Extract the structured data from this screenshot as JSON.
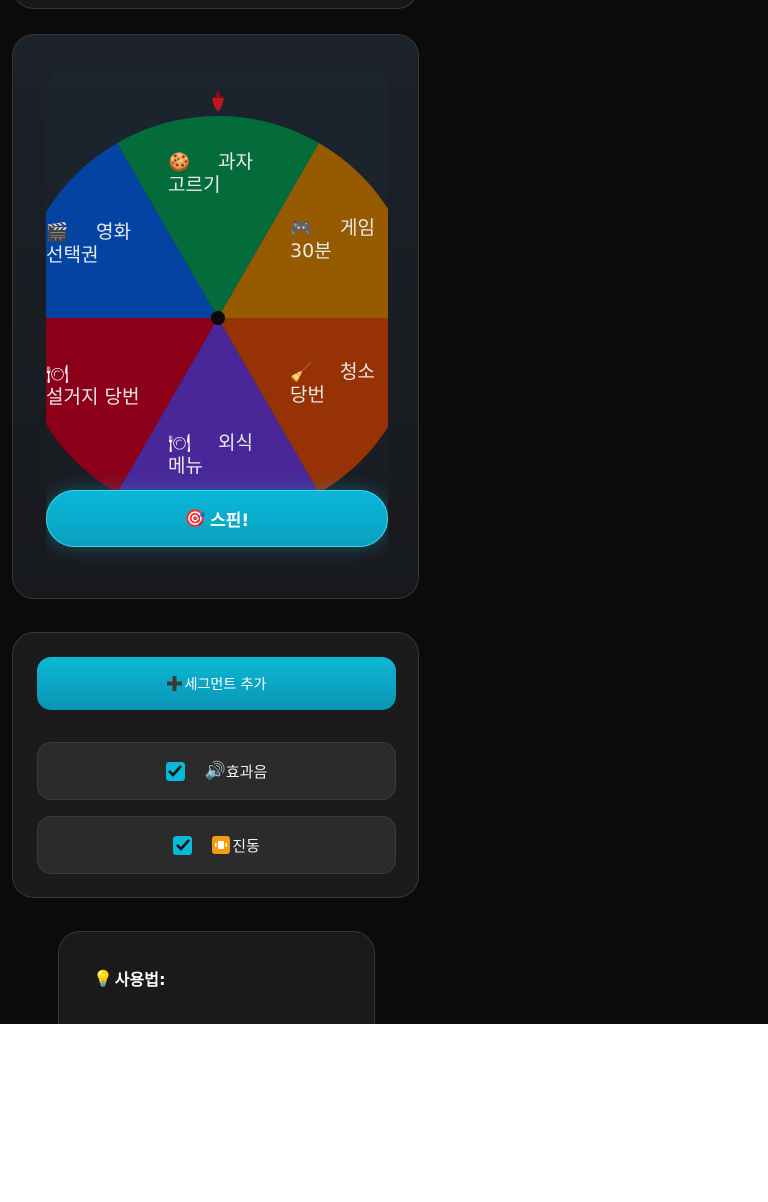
{
  "wheel": {
    "segments": [
      {
        "icon": "cookie-icon",
        "label_line1": "과자",
        "label_line2": "고르기",
        "color": "#046c3a"
      },
      {
        "icon": "gamepad-icon",
        "label_line1": "게임",
        "label_line2": "30분",
        "color": "#965a00"
      },
      {
        "icon": "broom-icon",
        "label_line1": "청소",
        "label_line2": "당번",
        "color": "#973205"
      },
      {
        "icon": "plate-icon",
        "label_line1": "외식",
        "label_line2": "메뉴",
        "color": "#4a2798"
      },
      {
        "icon": "dishes-icon",
        "label_line1": "",
        "label_line2": "설거지 당번",
        "color": "#8c0119"
      },
      {
        "icon": "clapper-icon",
        "label_line1": "영화",
        "label_line2": "선택권",
        "color": "#0443a2"
      }
    ],
    "spin_label": "스핀!",
    "spin_icon": "target-icon",
    "accent": "#09b8d8",
    "pointer_color": "#c0141e"
  },
  "controls": {
    "add_segment_label": "세그먼트 추가",
    "add_icon": "plus-icon",
    "sound": {
      "label": "효과음",
      "checked": true,
      "icon": "speaker-icon"
    },
    "vibration": {
      "label": "진동",
      "checked": true,
      "icon": "vibrate-icon"
    }
  },
  "help": {
    "title": "사용법:",
    "icon": "lightbulb-icon"
  }
}
